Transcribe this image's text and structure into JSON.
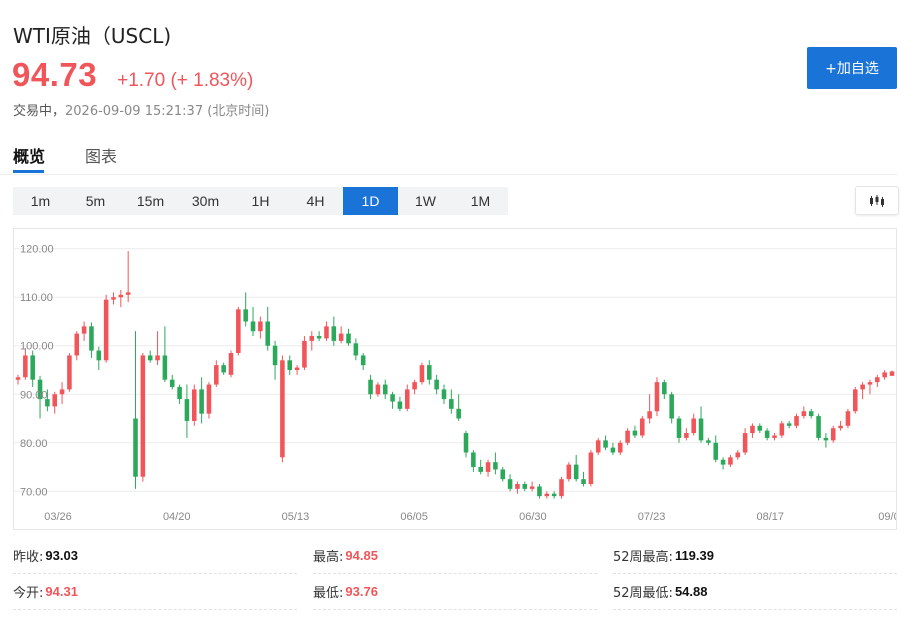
{
  "header": {
    "title": "WTI原油（USCL)",
    "price": "94.73",
    "change": "+1.70 (+ 1.83%)",
    "status_label": "交易中，",
    "datetime": "2026-09-09 15:21:37",
    "timezone": "(北京时间)",
    "add_watchlist_label": "+加自选"
  },
  "tabs": [
    {
      "label": "概览",
      "active": true
    },
    {
      "label": "图表",
      "active": false
    }
  ],
  "periods": [
    "1m",
    "5m",
    "15m",
    "30m",
    "1H",
    "4H",
    "1D",
    "1W",
    "1M"
  ],
  "active_period": "1D",
  "chart_icon": "candlestick-icon",
  "colors": {
    "up": "#f0555a",
    "down": "#2ca85b",
    "accent": "#1a73d6"
  },
  "chart_data": {
    "type": "candlestick",
    "y_ticks": [
      "120.00",
      "110.00",
      "100.00",
      "90.00",
      "80.00",
      "70.00"
    ],
    "ylim": [
      68,
      122
    ],
    "x_tick_labels": [
      "03/26",
      "04/20",
      "05/13",
      "06/05",
      "06/30",
      "07/23",
      "08/17",
      "09/0"
    ],
    "grid": true,
    "candles": [
      [
        93.0,
        94.0,
        92.0,
        93.5
      ],
      [
        93.5,
        99.5,
        93.0,
        98.0
      ],
      [
        98.0,
        99.0,
        91.5,
        93.0
      ],
      [
        93.0,
        93.8,
        85.0,
        89.0
      ],
      [
        89.0,
        91.0,
        86.5,
        87.5
      ],
      [
        87.5,
        90.5,
        86.0,
        90.0
      ],
      [
        90.0,
        92.5,
        88.0,
        91.0
      ],
      [
        91.0,
        98.5,
        90.5,
        98.0
      ],
      [
        98.0,
        103.0,
        97.0,
        102.5
      ],
      [
        102.5,
        105.0,
        101.0,
        104.0
      ],
      [
        104.0,
        104.8,
        97.5,
        99.0
      ],
      [
        99.0,
        99.8,
        95.0,
        97.0
      ],
      [
        97.0,
        110.5,
        96.5,
        109.5
      ],
      [
        109.5,
        111.0,
        108.5,
        110.0
      ],
      [
        110.0,
        111.5,
        108.0,
        110.5
      ],
      [
        110.5,
        119.5,
        109.0,
        111.0
      ],
      [
        85.0,
        103.0,
        70.5,
        73.0
      ],
      [
        73.0,
        98.5,
        72.0,
        98.0
      ],
      [
        98.0,
        99.0,
        96.5,
        97.0
      ],
      [
        97.0,
        103.0,
        96.0,
        98.0
      ],
      [
        98.0,
        104.0,
        92.5,
        93.0
      ],
      [
        93.0,
        94.0,
        91.0,
        91.5
      ],
      [
        91.5,
        92.0,
        88.0,
        89.0
      ],
      [
        89.0,
        92.0,
        81.0,
        84.5
      ],
      [
        84.5,
        92.0,
        83.5,
        91.0
      ],
      [
        91.0,
        93.5,
        84.0,
        86.0
      ],
      [
        86.0,
        92.5,
        85.0,
        92.0
      ],
      [
        92.0,
        97.0,
        91.5,
        96.0
      ],
      [
        96.0,
        96.5,
        94.0,
        94.5
      ],
      [
        94.0,
        99.0,
        93.5,
        98.5
      ],
      [
        98.5,
        108.0,
        98.0,
        107.5
      ],
      [
        107.5,
        111.0,
        104.0,
        105.0
      ],
      [
        105.0,
        108.0,
        102.0,
        103.0
      ],
      [
        103.0,
        106.0,
        101.5,
        105.0
      ],
      [
        105.0,
        108.0,
        99.0,
        100.0
      ],
      [
        100.0,
        101.0,
        93.0,
        96.0
      ],
      [
        77.0,
        98.0,
        76.0,
        97.0
      ],
      [
        97.0,
        98.0,
        94.0,
        95.0
      ],
      [
        95.0,
        96.0,
        94.0,
        95.5
      ],
      [
        95.5,
        102.0,
        95.0,
        101.0
      ],
      [
        101.0,
        103.0,
        99.0,
        102.0
      ],
      [
        102.0,
        103.0,
        101.0,
        101.5
      ],
      [
        101.5,
        105.0,
        101.0,
        104.0
      ],
      [
        104.0,
        106.0,
        100.0,
        101.0
      ],
      [
        101.0,
        104.0,
        100.5,
        102.5
      ],
      [
        102.5,
        103.5,
        100.0,
        100.5
      ],
      [
        100.5,
        101.5,
        97.0,
        98.0
      ],
      [
        98.0,
        98.5,
        95.0,
        96.0
      ],
      [
        93.0,
        94.0,
        89.0,
        90.0
      ],
      [
        90.0,
        92.5,
        89.5,
        92.0
      ],
      [
        92.0,
        93.0,
        89.0,
        90.0
      ],
      [
        90.0,
        90.5,
        87.0,
        88.5
      ],
      [
        88.5,
        89.5,
        86.5,
        87.0
      ],
      [
        87.0,
        92.0,
        86.5,
        91.0
      ],
      [
        91.0,
        93.0,
        90.0,
        92.5
      ],
      [
        92.5,
        96.5,
        92.0,
        96.0
      ],
      [
        96.0,
        97.0,
        92.0,
        93.0
      ],
      [
        93.0,
        94.0,
        90.0,
        91.0
      ],
      [
        91.0,
        92.0,
        88.0,
        89.0
      ],
      [
        89.0,
        91.0,
        86.0,
        87.0
      ],
      [
        87.0,
        90.0,
        84.5,
        85.0
      ],
      [
        82.0,
        82.5,
        77.0,
        78.0
      ],
      [
        78.0,
        78.5,
        74.0,
        75.0
      ],
      [
        75.0,
        76.5,
        73.5,
        74.0
      ],
      [
        74.0,
        76.5,
        73.0,
        76.0
      ],
      [
        76.0,
        78.0,
        73.5,
        74.5
      ],
      [
        74.5,
        75.0,
        72.0,
        72.5
      ],
      [
        72.5,
        73.5,
        70.0,
        70.5
      ],
      [
        70.5,
        72.0,
        69.5,
        71.5
      ],
      [
        71.5,
        72.0,
        70.0,
        70.5
      ],
      [
        70.5,
        72.0,
        70.0,
        71.0
      ],
      [
        71.0,
        71.5,
        68.5,
        69.0
      ],
      [
        69.0,
        70.0,
        68.5,
        69.5
      ],
      [
        69.5,
        70.0,
        68.5,
        69.0
      ],
      [
        69.0,
        73.0,
        68.5,
        72.5
      ],
      [
        72.5,
        76.0,
        72.0,
        75.5
      ],
      [
        75.5,
        77.5,
        72.0,
        72.5
      ],
      [
        72.5,
        74.0,
        71.0,
        71.5
      ],
      [
        71.5,
        78.5,
        71.0,
        78.0
      ],
      [
        78.0,
        81.0,
        77.5,
        80.5
      ],
      [
        80.5,
        81.5,
        78.5,
        79.0
      ],
      [
        79.0,
        80.0,
        77.5,
        78.0
      ],
      [
        78.0,
        80.5,
        77.5,
        80.0
      ],
      [
        80.0,
        83.0,
        79.5,
        82.5
      ],
      [
        82.5,
        83.5,
        81.0,
        81.5
      ],
      [
        81.5,
        85.5,
        81.0,
        85.0
      ],
      [
        85.0,
        90.0,
        84.0,
        86.5
      ],
      [
        86.5,
        93.5,
        85.5,
        92.5
      ],
      [
        92.5,
        93.0,
        89.0,
        90.0
      ],
      [
        90.0,
        90.5,
        84.0,
        85.0
      ],
      [
        85.0,
        85.5,
        80.0,
        81.0
      ],
      [
        81.0,
        83.0,
        80.5,
        82.0
      ],
      [
        82.0,
        86.0,
        81.5,
        85.0
      ],
      [
        85.0,
        87.5,
        80.0,
        80.5
      ],
      [
        80.5,
        81.0,
        79.5,
        80.0
      ],
      [
        80.0,
        81.5,
        76.0,
        76.5
      ],
      [
        76.5,
        77.0,
        74.5,
        75.5
      ],
      [
        75.5,
        77.5,
        75.0,
        77.0
      ],
      [
        77.0,
        78.5,
        76.5,
        78.0
      ],
      [
        78.0,
        83.0,
        77.5,
        82.0
      ],
      [
        82.0,
        84.0,
        81.0,
        83.5
      ],
      [
        83.5,
        84.0,
        82.0,
        82.5
      ],
      [
        82.5,
        83.0,
        80.5,
        81.0
      ],
      [
        81.0,
        82.0,
        80.5,
        81.5
      ],
      [
        81.5,
        84.5,
        81.0,
        84.0
      ],
      [
        84.0,
        84.5,
        83.0,
        83.5
      ],
      [
        83.5,
        86.0,
        83.0,
        85.5
      ],
      [
        85.5,
        87.5,
        85.0,
        86.5
      ],
      [
        86.5,
        87.0,
        85.0,
        85.5
      ],
      [
        85.5,
        86.0,
        80.5,
        81.0
      ],
      [
        81.0,
        82.0,
        79.0,
        80.5
      ],
      [
        80.5,
        83.5,
        80.0,
        83.0
      ],
      [
        83.0,
        84.5,
        82.5,
        83.5
      ],
      [
        83.5,
        87.0,
        83.0,
        86.5
      ],
      [
        86.5,
        91.5,
        86.0,
        91.0
      ],
      [
        91.0,
        92.5,
        89.0,
        92.0
      ],
      [
        92.0,
        93.0,
        90.0,
        92.5
      ],
      [
        92.5,
        94.0,
        91.5,
        93.5
      ],
      [
        93.5,
        95.0,
        93.0,
        94.5
      ],
      [
        93.8,
        94.9,
        93.8,
        94.7
      ]
    ]
  },
  "stats": [
    {
      "label": "昨收:",
      "value": "93.03",
      "tone": "neutral"
    },
    {
      "label": "最高:",
      "value": "94.85",
      "tone": "up"
    },
    {
      "label": "52周最高:",
      "value": "119.39",
      "tone": "neutral"
    },
    {
      "label": "今开:",
      "value": "94.31",
      "tone": "up"
    },
    {
      "label": "最低:",
      "value": "93.76",
      "tone": "up"
    },
    {
      "label": "52周最低:",
      "value": "54.88",
      "tone": "neutral"
    }
  ]
}
